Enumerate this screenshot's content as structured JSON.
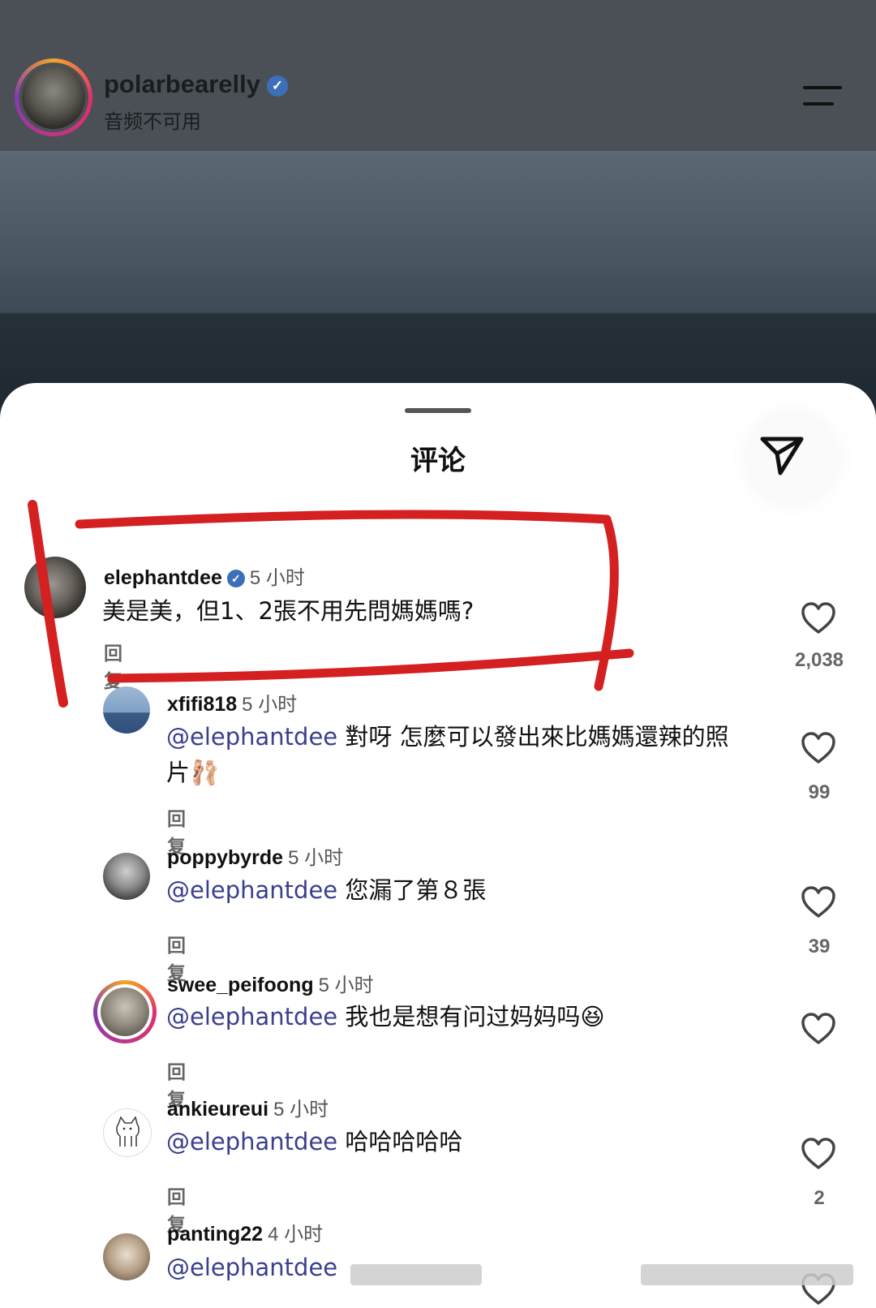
{
  "header": {
    "top_partial_text": "polarbearelly",
    "username": "polarbearelly",
    "subtitle": "音频不可用",
    "verified_glyph": "✓"
  },
  "sheet": {
    "title": "评论"
  },
  "comments": [
    {
      "user": "elephantdee",
      "verified": true,
      "time": "5 小时",
      "mention": "",
      "text": "美是美，但1、2張不用先問媽媽嗎?",
      "reply": "回复",
      "likes": "2,038"
    },
    {
      "user": "xfifi818",
      "time": "5 小时",
      "mention": "@elephantdee",
      "text": " 對呀 怎麼可以發出來比媽媽還辣的照片🩰",
      "reply": "回复",
      "likes": "99"
    },
    {
      "user": "poppybyrde",
      "time": "5 小时",
      "mention": "@elephantdee",
      "text": " 您漏了第８張",
      "reply": "回复",
      "likes": "39"
    },
    {
      "user": "swee_peifoong",
      "time": "5 小时",
      "mention": "@elephantdee",
      "text": " 我也是想有问过妈妈吗😆",
      "reply": "回复",
      "likes": ""
    },
    {
      "user": "ankieureui",
      "time": "5 小时",
      "mention": "@elephantdee",
      "text": " 哈哈哈哈哈",
      "reply": "回复",
      "likes": "2"
    },
    {
      "user": "panting22",
      "time": "4 小时",
      "mention": "@elephantdee",
      "text": "",
      "reply": "",
      "likes": ""
    }
  ],
  "icons": {
    "menu": "menu-lines-icon",
    "send": "send-paper-plane-icon",
    "like": "heart-outline-icon"
  },
  "colors": {
    "annotation": "#d42020",
    "mention": "#3a3f8f"
  }
}
